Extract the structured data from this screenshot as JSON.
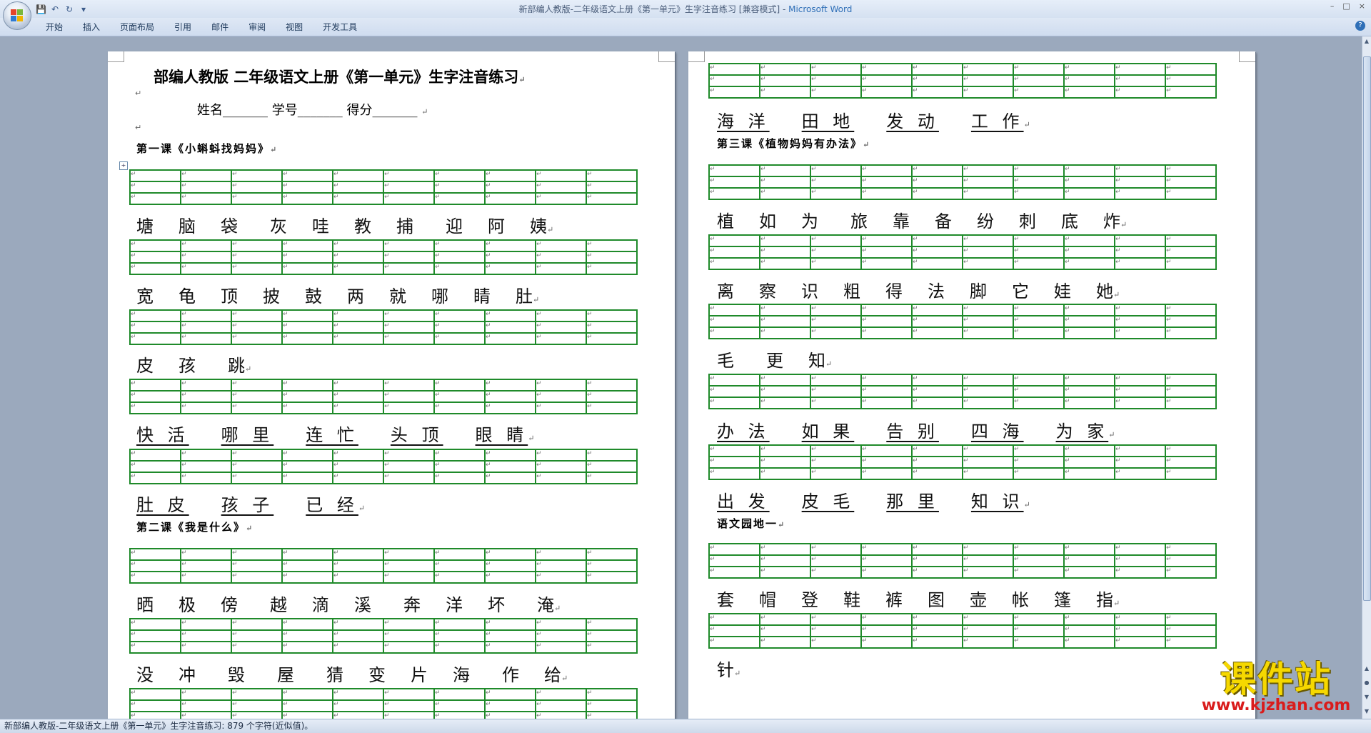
{
  "window": {
    "title": "新部编人教版-二年级语文上册《第一单元》生字注音练习 [兼容模式]",
    "app_name": "Microsoft Word",
    "controls": [
      "–",
      "□",
      "×"
    ]
  },
  "quick_access": {
    "icons": [
      "save-icon",
      "undo-icon",
      "redo-icon",
      "customize-icon"
    ]
  },
  "ribbon": {
    "tabs": [
      "开始",
      "插入",
      "页面布局",
      "引用",
      "邮件",
      "审阅",
      "视图",
      "开发工具"
    ],
    "help": "?"
  },
  "mark": "↵",
  "page1": {
    "title": "部编人教版 二年级语文上册《第一单元》生字注音练习",
    "student_line": "姓名_______  学号_______  得分_______",
    "lesson1": "第一课《小蝌蚪找妈妈》",
    "rows": [
      [
        "塘",
        "脑",
        "袋",
        "灰",
        "哇",
        "教",
        "捕",
        "迎",
        "阿",
        "姨"
      ],
      [
        "宽",
        "龟",
        "顶",
        "披",
        "鼓",
        "两",
        "就",
        "哪",
        "睛",
        "肚"
      ],
      [
        "皮",
        "孩",
        "跳"
      ],
      [
        "快 活",
        "哪 里",
        "连 忙",
        "头 顶",
        "眼 睛"
      ],
      [
        "肚 皮",
        "孩 子",
        "已 经"
      ],
      [
        "晒",
        "极",
        "傍",
        "越",
        "滴",
        "溪",
        "奔",
        "洋",
        "坏",
        "淹"
      ],
      [
        "没",
        "冲",
        "毁",
        "屋",
        "猜",
        "变",
        "片",
        "海",
        "作",
        "给"
      ]
    ],
    "lesson2": "第二课《我是什么》"
  },
  "page2": {
    "rows": [
      [
        "海 洋",
        "田 地",
        "发 动",
        "工 作"
      ],
      [
        "植",
        "如",
        "为",
        "旅",
        "靠",
        "备",
        "纷",
        "刺",
        "底",
        "炸"
      ],
      [
        "离",
        "察",
        "识",
        "粗",
        "得",
        "法",
        "脚",
        "它",
        "娃",
        "她"
      ],
      [
        "毛",
        "更",
        "知"
      ],
      [
        "办 法",
        "如 果",
        "告 别",
        "四 海",
        "为 家"
      ],
      [
        "出 发",
        "皮 毛",
        "那 里",
        "知 识"
      ],
      [
        "套",
        "帽",
        "登",
        "鞋",
        "裤",
        "图",
        "壶",
        "帐",
        "篷",
        "指"
      ],
      [
        "针"
      ]
    ],
    "lesson3": "第三课《植物妈妈有办法》",
    "garden": "语文园地一"
  },
  "status": {
    "text": "新部编人教版-二年级语文上册《第一单元》生字注音练习: 879 个字符(近似值)。"
  },
  "watermark": {
    "main": "课件站",
    "url": "www.kjzhan.com"
  }
}
